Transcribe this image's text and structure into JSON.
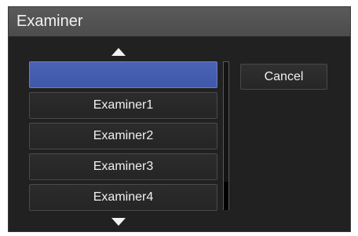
{
  "window": {
    "title": "Examiner"
  },
  "list": {
    "scroll_up_icon": "triangle-up",
    "scroll_down_icon": "triangle-down",
    "selected_index": 0,
    "items": [
      {
        "label": ""
      },
      {
        "label": "Examiner1"
      },
      {
        "label": "Examiner2"
      },
      {
        "label": "Examiner3"
      },
      {
        "label": "Examiner4"
      }
    ]
  },
  "buttons": {
    "cancel_label": "Cancel"
  },
  "colors": {
    "dialog_bg": "#212121",
    "titlebar_bg": "#525252",
    "selection": "#4560b0",
    "text": "#f0f0f0"
  }
}
